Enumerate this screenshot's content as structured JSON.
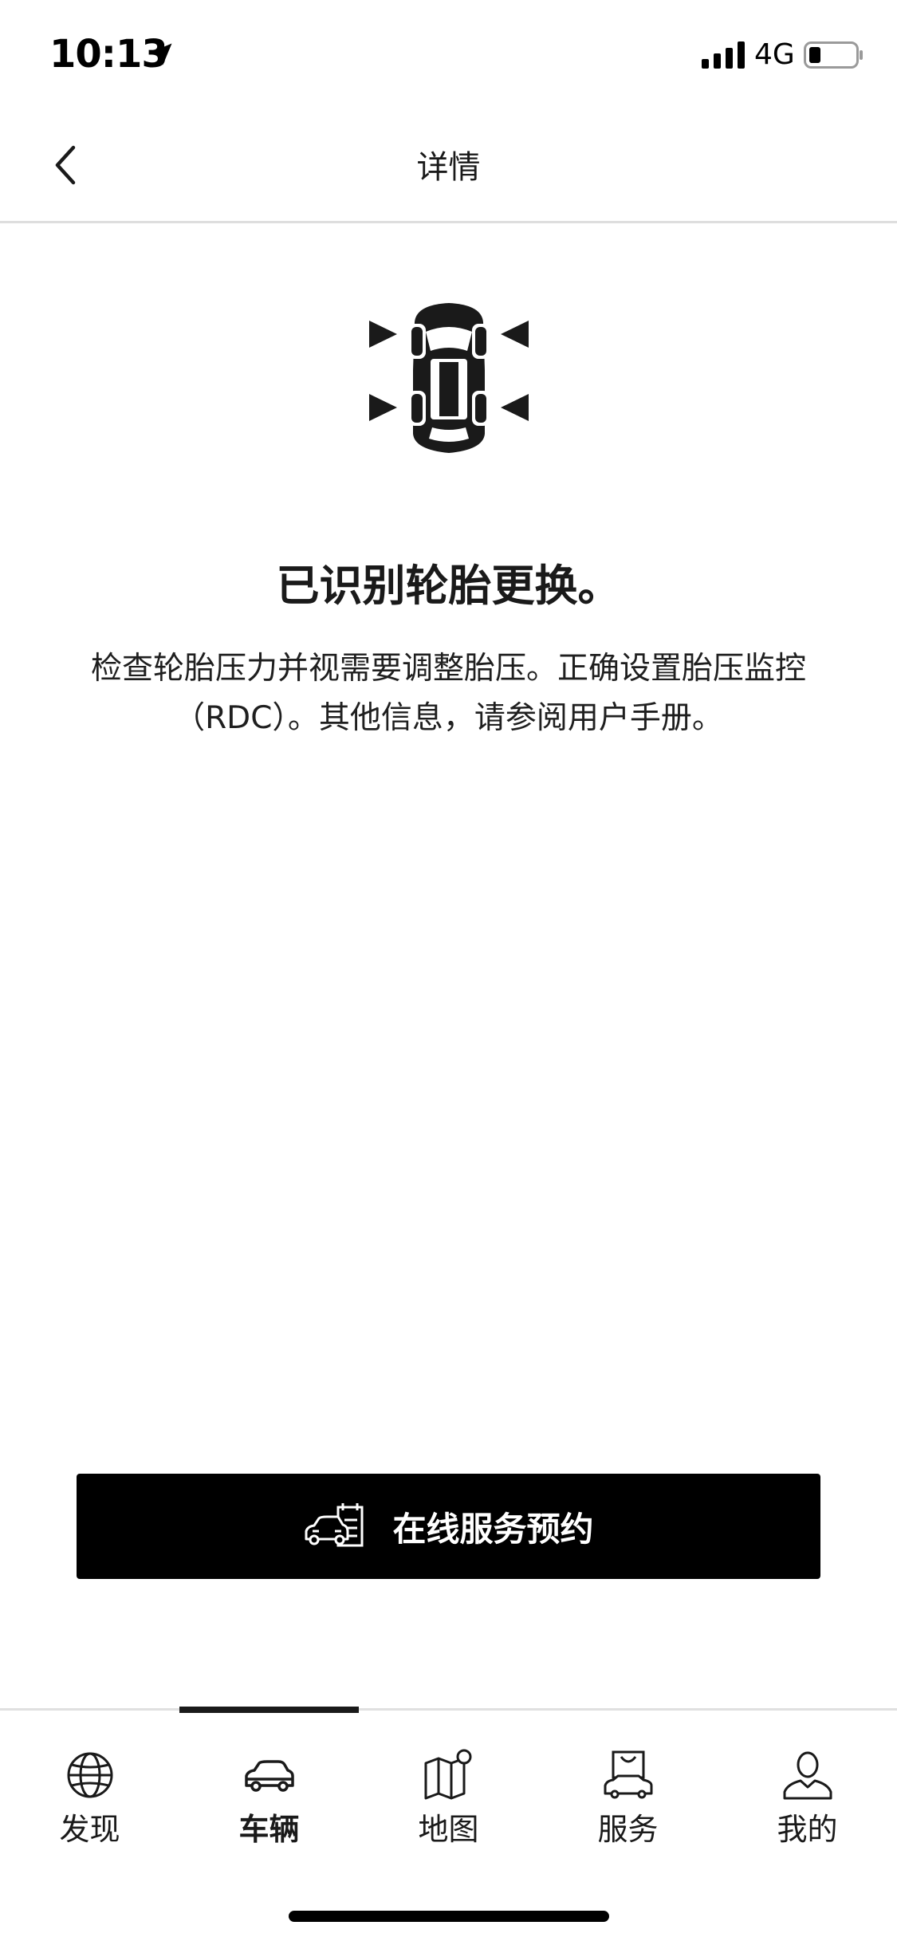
{
  "status_bar": {
    "time": "10:13",
    "network": "4G"
  },
  "nav": {
    "title": "详情"
  },
  "content": {
    "headline": "已识别轮胎更换。",
    "body": "检查轮胎压力并视需要调整胎压。正确设置胎压监控（RDC）。其他信息，请参阅用户手册。"
  },
  "cta": {
    "label": "在线服务预约"
  },
  "tabs": [
    {
      "label": "发现",
      "icon": "globe-icon",
      "active": false
    },
    {
      "label": "车辆",
      "icon": "car-icon",
      "active": true
    },
    {
      "label": "地图",
      "icon": "map-icon",
      "active": false
    },
    {
      "label": "服务",
      "icon": "service-bag-icon",
      "active": false
    },
    {
      "label": "我的",
      "icon": "user-icon",
      "active": false
    }
  ],
  "colors": {
    "accent": "#000000",
    "background": "#ffffff",
    "divider": "#dedede"
  }
}
